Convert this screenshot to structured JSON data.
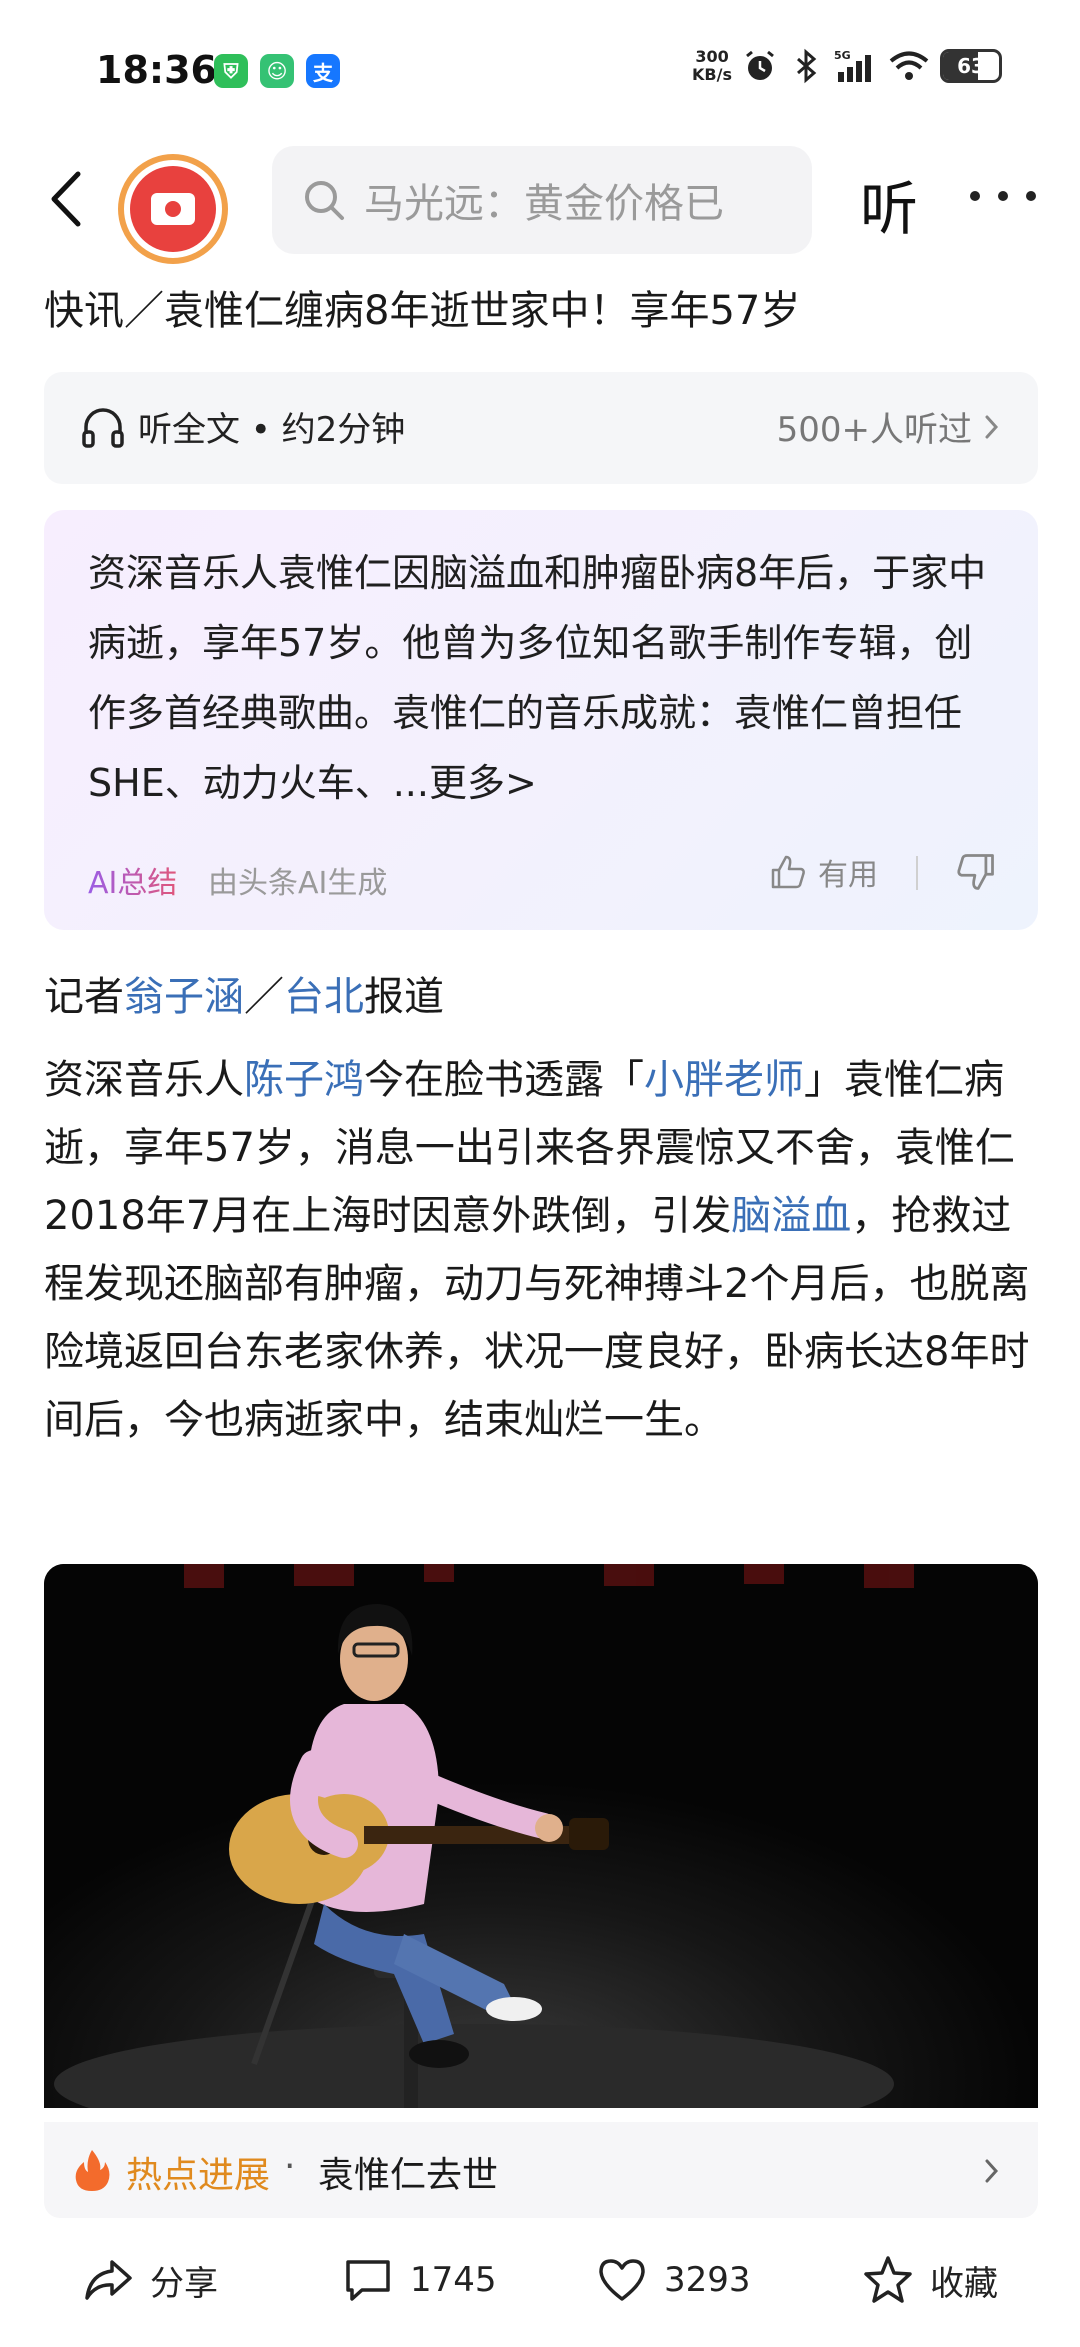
{
  "status_bar": {
    "time": "18:36",
    "net_speed_value": "300",
    "net_speed_unit": "KB/s",
    "network": "5G",
    "battery": "63",
    "battery_level": 0.63
  },
  "header": {
    "search_placeholder": "马光远：黄金价格已",
    "listen_label": "听"
  },
  "article": {
    "title": "快讯／袁惟仁缠病8年逝世家中！享年57岁",
    "listen_card": {
      "label": "听全文 • 约2分钟",
      "count": "500+人听过"
    },
    "ai_summary": {
      "text": "资深音乐人袁惟仁因脑溢血和肿瘤卧病8年后，于家中病逝，享年57岁。他曾为多位知名歌手制作专辑，创作多首经典歌曲。袁惟仁的音乐成就：袁惟仁曾担任SHE、动力火车、",
      "more": "...更多>",
      "label": "AI总结",
      "source": "由头条AI生成",
      "useful": "有用"
    },
    "byline": {
      "prefix": "记者",
      "reporter": "翁子涵",
      "sep": "／",
      "location": "台北",
      "suffix": "报道"
    },
    "body": {
      "p1": "资深音乐人",
      "link1": "陈子鸿",
      "p2": "今在脸书透露「",
      "link2": "小胖老师",
      "p3": "」袁惟仁病逝，享年57岁，消息一出引来各界震惊又不舍，袁惟仁2018年7月在上海时因意外跌倒，引发",
      "link3": "脑溢血",
      "p4": "，抢救过程发现还脑部有肿瘤，动刀与死神搏斗2个月后，也脱离险境返回台东老家休养，状况一度良好，卧病长达8年时间后，今也病逝家中，结束灿烂一生。"
    },
    "hot_topic": {
      "label": "热点进展",
      "dot": "·",
      "topic": "袁惟仁去世"
    }
  },
  "bottom_bar": {
    "share": "分享",
    "comments": "1745",
    "likes": "3293",
    "favorite": "收藏"
  },
  "colors": {
    "link": "#3a6fb7",
    "hot_label": "#e08a1e",
    "avatar_red": "#e8413e",
    "avatar_ring": "#f2a14a"
  }
}
